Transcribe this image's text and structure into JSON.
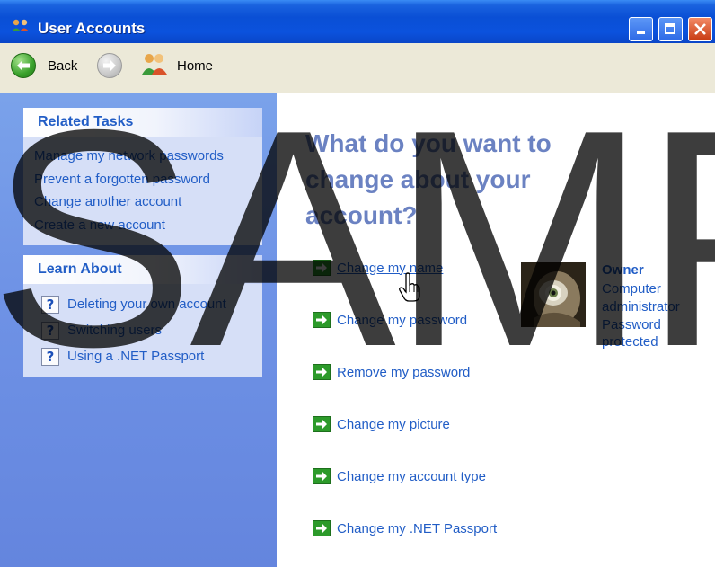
{
  "window": {
    "title": "User Accounts",
    "caption_buttons": [
      "minimize-icon",
      "maximize-icon",
      "close-icon"
    ],
    "title_color": "#0a4fd5"
  },
  "toolbar": {
    "back_label": "Back",
    "forward_icon": "forward-arrow-icon",
    "home_label": "Home"
  },
  "related_tasks": {
    "title": "Related Tasks",
    "items": [
      {
        "label": "Manage my network passwords"
      },
      {
        "label": "Prevent a forgotten password"
      },
      {
        "label": "Change another account"
      },
      {
        "label": "Create a new account"
      }
    ]
  },
  "learn_about": {
    "title": "Learn About",
    "items": [
      {
        "label": "Deleting your own account",
        "icon": "help-icon"
      },
      {
        "label": "Switching users",
        "icon": "help-icon"
      },
      {
        "label": "Using a .NET Passport",
        "icon": "help-icon"
      }
    ]
  },
  "main": {
    "heading": "What do you want to change about your account?",
    "actions": [
      {
        "label": "Change my name",
        "hovered": true
      },
      {
        "label": "Change my password"
      },
      {
        "label": "Remove my password"
      },
      {
        "label": "Change my picture"
      },
      {
        "label": "Change my account type"
      },
      {
        "label": "Change my .NET Passport"
      }
    ]
  },
  "account": {
    "name": "Owner",
    "details": [
      "Computer",
      "administrator",
      "Password",
      "protected"
    ],
    "picture": "owl-picture"
  },
  "watermark": {
    "text": "SAMP"
  },
  "colors": {
    "link": "#215dc6",
    "heading": "#6b82c2",
    "left_pane": "#6f93e6",
    "action_arrow": "#2c9a2a"
  }
}
